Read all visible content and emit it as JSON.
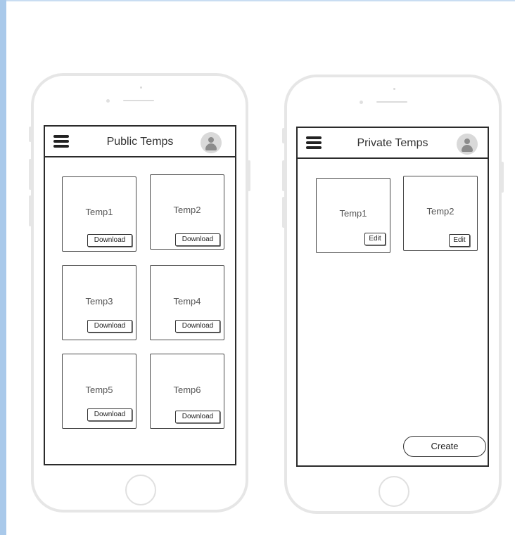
{
  "public_screen": {
    "title": "Public Temps",
    "cards": [
      {
        "label": "Temp1",
        "button": "Download"
      },
      {
        "label": "Temp2",
        "button": "Download"
      },
      {
        "label": "Temp3",
        "button": "Download"
      },
      {
        "label": "Temp4",
        "button": "Download"
      },
      {
        "label": "Temp5",
        "button": "Download"
      },
      {
        "label": "Temp6",
        "button": "Download"
      }
    ]
  },
  "private_screen": {
    "title": "Private Temps",
    "cards": [
      {
        "label": "Temp1",
        "button": "Edit"
      },
      {
        "label": "Temp2",
        "button": "Edit"
      }
    ],
    "create_label": "Create"
  },
  "icons": {
    "menu": "hamburger-menu-icon",
    "avatar": "user-avatar-icon"
  },
  "colors": {
    "accent_strip": "#a9c9ea",
    "phone_frame": "#e6e6e6",
    "screen_border": "#2b2b2b"
  }
}
